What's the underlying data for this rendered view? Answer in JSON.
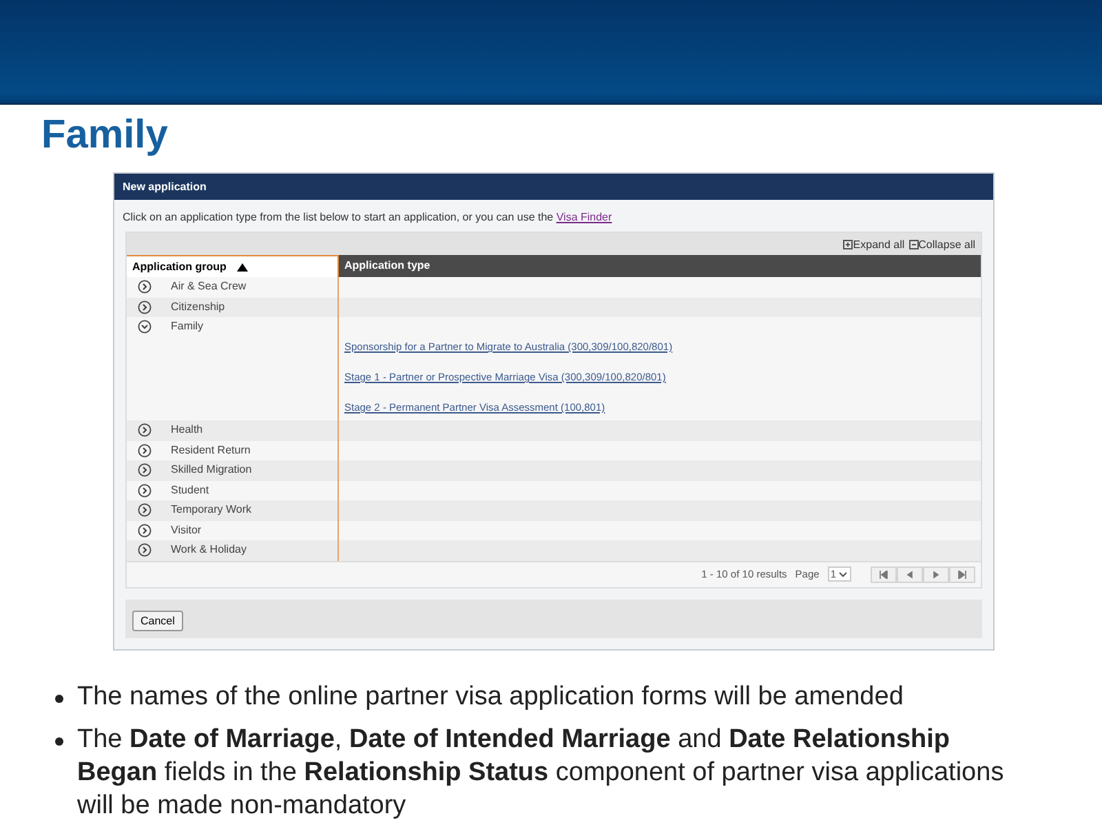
{
  "slide_title": "Family",
  "window": {
    "title": "New application",
    "intro": "Click on an application type from the list below to start an application, or you can use the ",
    "intro_link": "Visa Finder"
  },
  "toolbar": {
    "expand_all": "Expand all",
    "collapse_all": "Collapse all"
  },
  "table": {
    "columns": [
      {
        "label": "Application group",
        "sorted_ascending": true
      },
      {
        "label": "Application type"
      }
    ],
    "groups": [
      {
        "label": "Air & Sea Crew",
        "expanded": false
      },
      {
        "label": "Citizenship",
        "expanded": false
      },
      {
        "label": "Family",
        "expanded": true,
        "children": [
          {
            "label": "Sponsorship for a Partner to Migrate to Australia (300,309/100,820/801)"
          },
          {
            "label": "Stage 1 - Partner or Prospective Marriage Visa (300,309/100,820/801)"
          },
          {
            "label": "Stage 2 - Permanent Partner Visa Assessment (100,801)"
          }
        ]
      },
      {
        "label": "Health",
        "expanded": false
      },
      {
        "label": "Resident Return",
        "expanded": false
      },
      {
        "label": "Skilled Migration",
        "expanded": false
      },
      {
        "label": "Student",
        "expanded": false
      },
      {
        "label": "Temporary Work",
        "expanded": false
      },
      {
        "label": "Visitor",
        "expanded": false
      },
      {
        "label": "Work & Holiday",
        "expanded": false
      }
    ]
  },
  "pager": {
    "results": "1 - 10 of 10 results",
    "page_label": "Page",
    "page": "1"
  },
  "buttons": [
    "Cancel"
  ],
  "bullets": [
    "The names of the online partner visa application forms will be amended",
    "The **Date of Marriage**, **Date of Intended Marriage** and **Date Relationship Began** fields in the **Relationship Status** component of partner visa applications will be made non-mandatory"
  ]
}
